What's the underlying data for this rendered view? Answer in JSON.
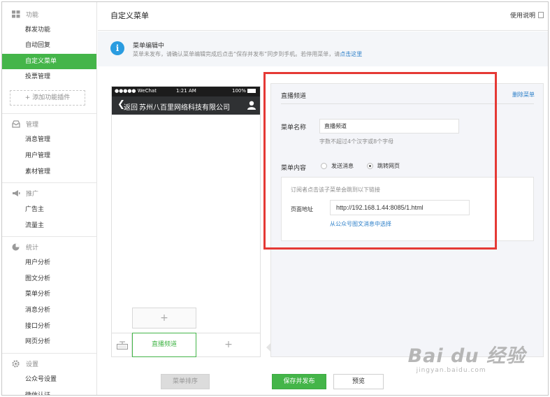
{
  "sidebar": {
    "sections": [
      {
        "title": "功能",
        "icon": "grid-icon",
        "items": [
          "群发功能",
          "自动回复",
          "自定义菜单",
          "投票管理"
        ]
      },
      {
        "title": "管理",
        "icon": "inbox-icon",
        "items": [
          "消息管理",
          "用户管理",
          "素材管理"
        ]
      },
      {
        "title": "推广",
        "icon": "megaphone-icon",
        "items": [
          "广告主",
          "流量主"
        ]
      },
      {
        "title": "统计",
        "icon": "pie-chart-icon",
        "items": [
          "用户分析",
          "图文分析",
          "菜单分析",
          "消息分析",
          "接口分析",
          "网页分析"
        ]
      },
      {
        "title": "设置",
        "icon": "gear-icon",
        "items": [
          "公众号设置",
          "微信认证"
        ]
      }
    ],
    "active_item": "自定义菜单",
    "add_plugin": "+ 添加功能插件"
  },
  "header": {
    "title": "自定义菜单",
    "help": "使用说明"
  },
  "notice": {
    "title": "菜单编辑中",
    "desc": "菜单未发布，请确认菜单编辑完成后点击“保存并发布”同步到手机。若停用菜单，请",
    "link": "点击这里"
  },
  "phone": {
    "carrier": "●●●●● WeChat",
    "time": "1:21 AM",
    "battery": "100%",
    "back": "返回",
    "account": "苏州八百里网络科技有限公司",
    "sub_add": "+",
    "menu_current": "直播频道",
    "menu_add": "+"
  },
  "editor": {
    "heading": "直播频道",
    "delete": "删除菜单",
    "name_label": "菜单名称",
    "name_value": "直播频道",
    "name_hint": "字数不超过4个汉字或8个字母",
    "content_label": "菜单内容",
    "option_send": "发送消息",
    "option_jump": "跳转网页",
    "selected_option": "跳转网页",
    "jump_tip": "订阅者点击该子菜单会跳到以下链接",
    "url_label": "页面地址",
    "url_value": "http://192.168.1.44:8085/1.html",
    "choose_link": "从公众号图文消息中选择"
  },
  "buttons": {
    "sort": "菜单排序",
    "save": "保存并发布",
    "preview": "预览"
  },
  "watermark": {
    "brand": "Bai du 经验",
    "url": "jingyan.baidu.com"
  },
  "colors": {
    "accent": "#44b549",
    "link": "#2a7ec8",
    "highlight_box": "#e53935",
    "info": "#2a9ce0"
  }
}
